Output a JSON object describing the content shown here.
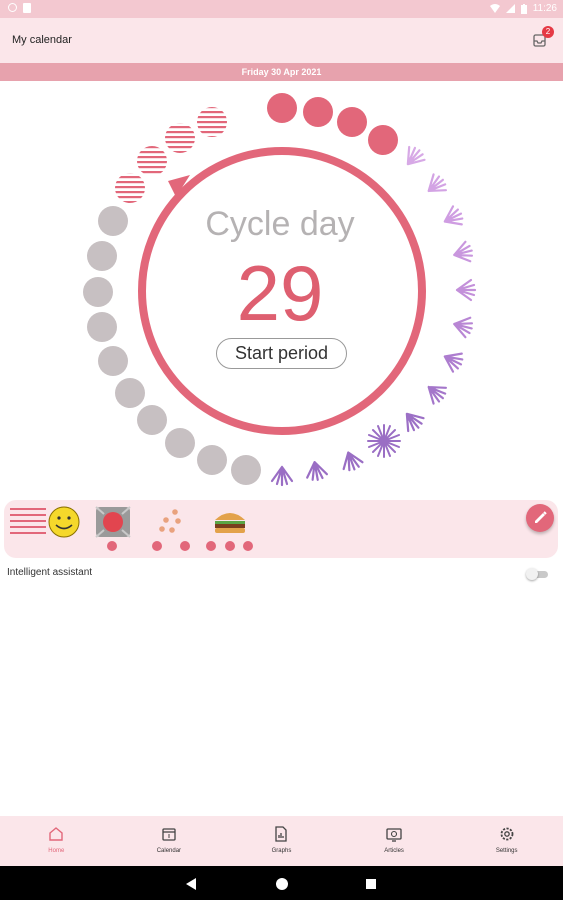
{
  "status_bar": {
    "time": "11:26"
  },
  "app_bar": {
    "title": "My calendar",
    "notification_count": "2"
  },
  "date_strip": {
    "text": "Friday 30 Apr 2021"
  },
  "cycle": {
    "title": "Cycle day",
    "day": "29",
    "start_button": "Start period",
    "colors": {
      "period": "#e2677a",
      "predicted": "#e2677a",
      "neutral": "#c7c0c2",
      "fertile": "#c08ad8",
      "ring": "#e2677a"
    }
  },
  "symptoms": {
    "items": [
      {
        "icon": "flow-lines-icon",
        "dots": 0
      },
      {
        "icon": "smiley-icon",
        "dots": 0
      },
      {
        "icon": "cramp-icon",
        "dots": 1
      },
      {
        "icon": "pimples-icon",
        "dots": 2
      },
      {
        "icon": "burger-icon",
        "dots": 3
      }
    ],
    "edit_icon": "pencil-icon"
  },
  "assistant": {
    "label": "Intelligent assistant",
    "enabled": false
  },
  "bottom_nav": {
    "items": [
      {
        "label": "Home",
        "icon": "home-icon",
        "active": true
      },
      {
        "label": "Calendar",
        "icon": "calendar-icon",
        "active": false
      },
      {
        "label": "Graphs",
        "icon": "graphs-icon",
        "active": false
      },
      {
        "label": "Articles",
        "icon": "articles-icon",
        "active": false
      },
      {
        "label": "Settings",
        "icon": "settings-icon",
        "active": false
      }
    ]
  }
}
